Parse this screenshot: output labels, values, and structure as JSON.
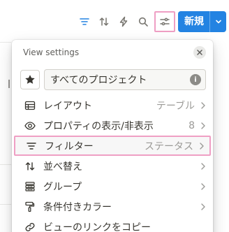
{
  "toolbar": {
    "icons": [
      "filter-lines-icon",
      "sort-arrows-icon",
      "lightning-icon",
      "search-icon",
      "sliders-icon"
    ],
    "new_label": "新規",
    "accent": "#2383e2"
  },
  "panel": {
    "title": "View settings",
    "view_name": "すべてのプロジェクト",
    "info_glyph": "i"
  },
  "menu": [
    {
      "label": "レイアウト",
      "value": "テーブル",
      "icon": "table-icon"
    },
    {
      "label": "プロパティの表示/非表示",
      "value": "8",
      "icon": "eye-icon"
    },
    {
      "label": "フィルター",
      "value": "ステータス",
      "icon": "filter-icon",
      "selected": true
    },
    {
      "label": "並べ替え",
      "value": "",
      "icon": "sort-icon"
    },
    {
      "label": "グループ",
      "value": "",
      "icon": "group-icon"
    },
    {
      "label": "条件付きカラー",
      "value": "",
      "icon": "paint-roller-icon"
    },
    {
      "label": "ビューのリンクをコピー",
      "value": "",
      "icon": "link-icon"
    }
  ]
}
